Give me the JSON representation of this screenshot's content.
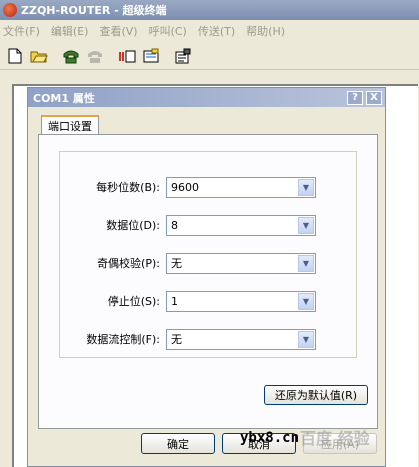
{
  "app": {
    "title": "ZZQH-ROUTER - 超级终端",
    "menu": [
      "文件(F)",
      "编辑(E)",
      "查看(V)",
      "呼叫(C)",
      "传送(T)",
      "帮助(H)"
    ],
    "toolbar_icons": [
      "new-icon",
      "open-icon",
      "phone-icon",
      "disconnect-icon",
      "send-receive-icon",
      "capture-icon",
      "properties-icon"
    ]
  },
  "dialog": {
    "title": "COM1 属性",
    "help_btn": "?",
    "close_btn": "X",
    "tab": "端口设置",
    "fields": [
      {
        "label": "每秒位数(B):",
        "value": "9600"
      },
      {
        "label": "数据位(D):",
        "value": "8"
      },
      {
        "label": "奇偶校验(P):",
        "value": "无"
      },
      {
        "label": "停止位(S):",
        "value": "1"
      },
      {
        "label": "数据流控制(F):",
        "value": "无"
      }
    ],
    "restore_btn": "还原为默认值(R)",
    "ok_btn": "确定",
    "cancel_btn": "取消",
    "apply_btn": "应用(A)"
  },
  "watermark": {
    "text": "ybx8.cn",
    "logo": "百度 经验"
  }
}
